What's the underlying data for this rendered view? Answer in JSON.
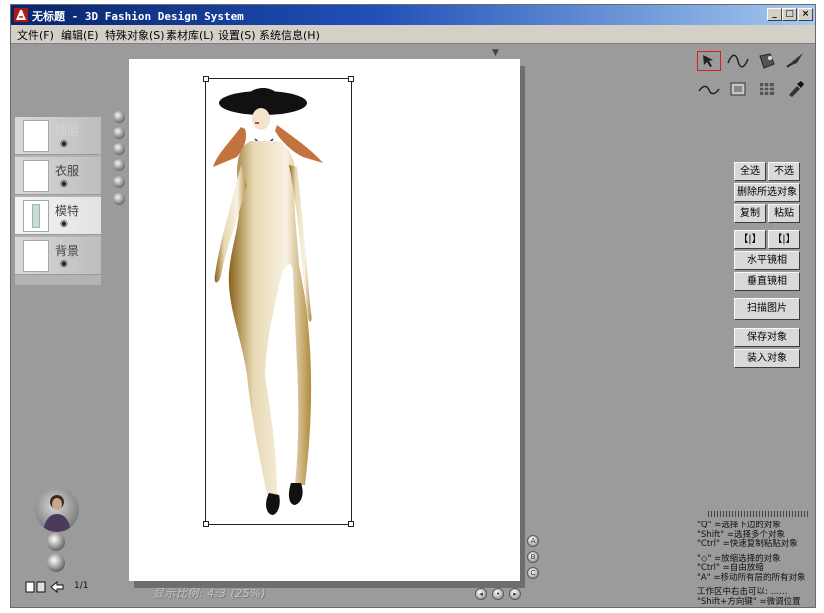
{
  "window": {
    "title": "无标题 - 3D Fashion Design System",
    "controls": {
      "minimize": "_",
      "maximize": "□",
      "close": "×"
    }
  },
  "menu": [
    "文件(F)",
    "编辑(E)",
    "特殊对象(S)",
    "素材库(L)",
    "设置(S)",
    "系统信息(H)"
  ],
  "layers": [
    {
      "name": "顶层",
      "visible_icon": "eye-icon",
      "active": false,
      "faded": true
    },
    {
      "name": "衣服",
      "visible_icon": "eye-icon",
      "active": false,
      "faded": false
    },
    {
      "name": "模特",
      "visible_icon": "eye-icon",
      "active": true,
      "faded": false
    },
    {
      "name": "背景",
      "visible_icon": "eye-icon",
      "active": false,
      "faded": false
    }
  ],
  "canvas": {
    "scale_label": "显示比例: 4:3 (25%)"
  },
  "tools": [
    {
      "name": "pick-tool-icon",
      "selected": true
    },
    {
      "name": "curve-tool-icon",
      "selected": false
    },
    {
      "name": "fill-tool-icon",
      "selected": false
    },
    {
      "name": "brush-tool-icon",
      "selected": false
    },
    {
      "name": "wave-tool-icon",
      "selected": false
    },
    {
      "name": "texture-tool-icon",
      "selected": false
    },
    {
      "name": "grid-tool-icon",
      "selected": false
    },
    {
      "name": "eyedropper-tool-icon",
      "selected": false
    }
  ],
  "buttons": {
    "select_all": "全选",
    "deselect": "不选",
    "delete_selected": "删除所选对象",
    "copy": "复制",
    "paste": "粘贴",
    "arrange_1": "【|】",
    "arrange_2": "【|】",
    "mirror_horizontal": "水平镜相",
    "mirror_vertical": "垂直镜相",
    "scan_image": "扫描图片",
    "save_object": "保存对象",
    "load_object": "装入对象"
  },
  "page_indicator": "1/1",
  "nav_buttons": [
    "A",
    "B",
    "C"
  ],
  "help_lines": [
    "\"Q\" =选择下边的对象",
    "\"Shift\" =选择多个对象",
    "\"Ctrl\" =快速复制粘贴对象",
    "",
    "\"◇\" =放缩选择的对象",
    "\"Ctrl\" =自由放缩",
    "\"A\" =移动所有层的所有对象",
    "",
    "工作区中右击可以: ……",
    "\"Shift+方向键\" =微调位置"
  ],
  "colors": {
    "title_gradient_start": "#08246b",
    "title_gradient_end": "#a6caf0",
    "workspace": "#9b9b9b",
    "tool_selected_border": "#d62020"
  }
}
